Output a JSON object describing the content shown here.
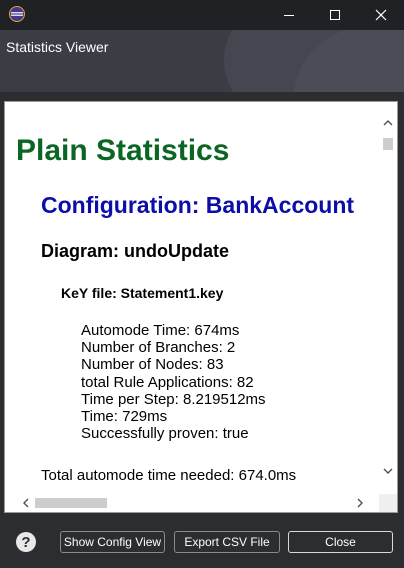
{
  "window": {
    "title": "Statistics Viewer",
    "minimize_icon": "minimize-icon",
    "maximize_icon": "maximize-icon",
    "close_icon": "close-icon"
  },
  "report": {
    "heading": "Plain Statistics",
    "configuration": "Configuration: BankAccount",
    "diagram": "Diagram: undoUpdate",
    "key_file": "KeY file: Statement1.key",
    "stats": [
      "Automode Time: 674ms",
      "Number of Branches: 2",
      "Number of Nodes: 83",
      "total Rule Applications: 82",
      "Time per Step: 8.219512ms",
      "Time: 729ms",
      "Successfully proven: true"
    ],
    "total": "Total automode time needed: 674.0ms"
  },
  "scroll": {
    "vertical_position": 0.0,
    "horizontal_position": 0.1
  },
  "buttons": {
    "show_config": "Show Config View",
    "export_csv": "Export CSV File",
    "close": "Close"
  },
  "help_icon": "help-icon",
  "colors": {
    "heading_green": "#0b6623",
    "config_blue": "#0d0da8",
    "dark_bg": "#2b2d30"
  }
}
